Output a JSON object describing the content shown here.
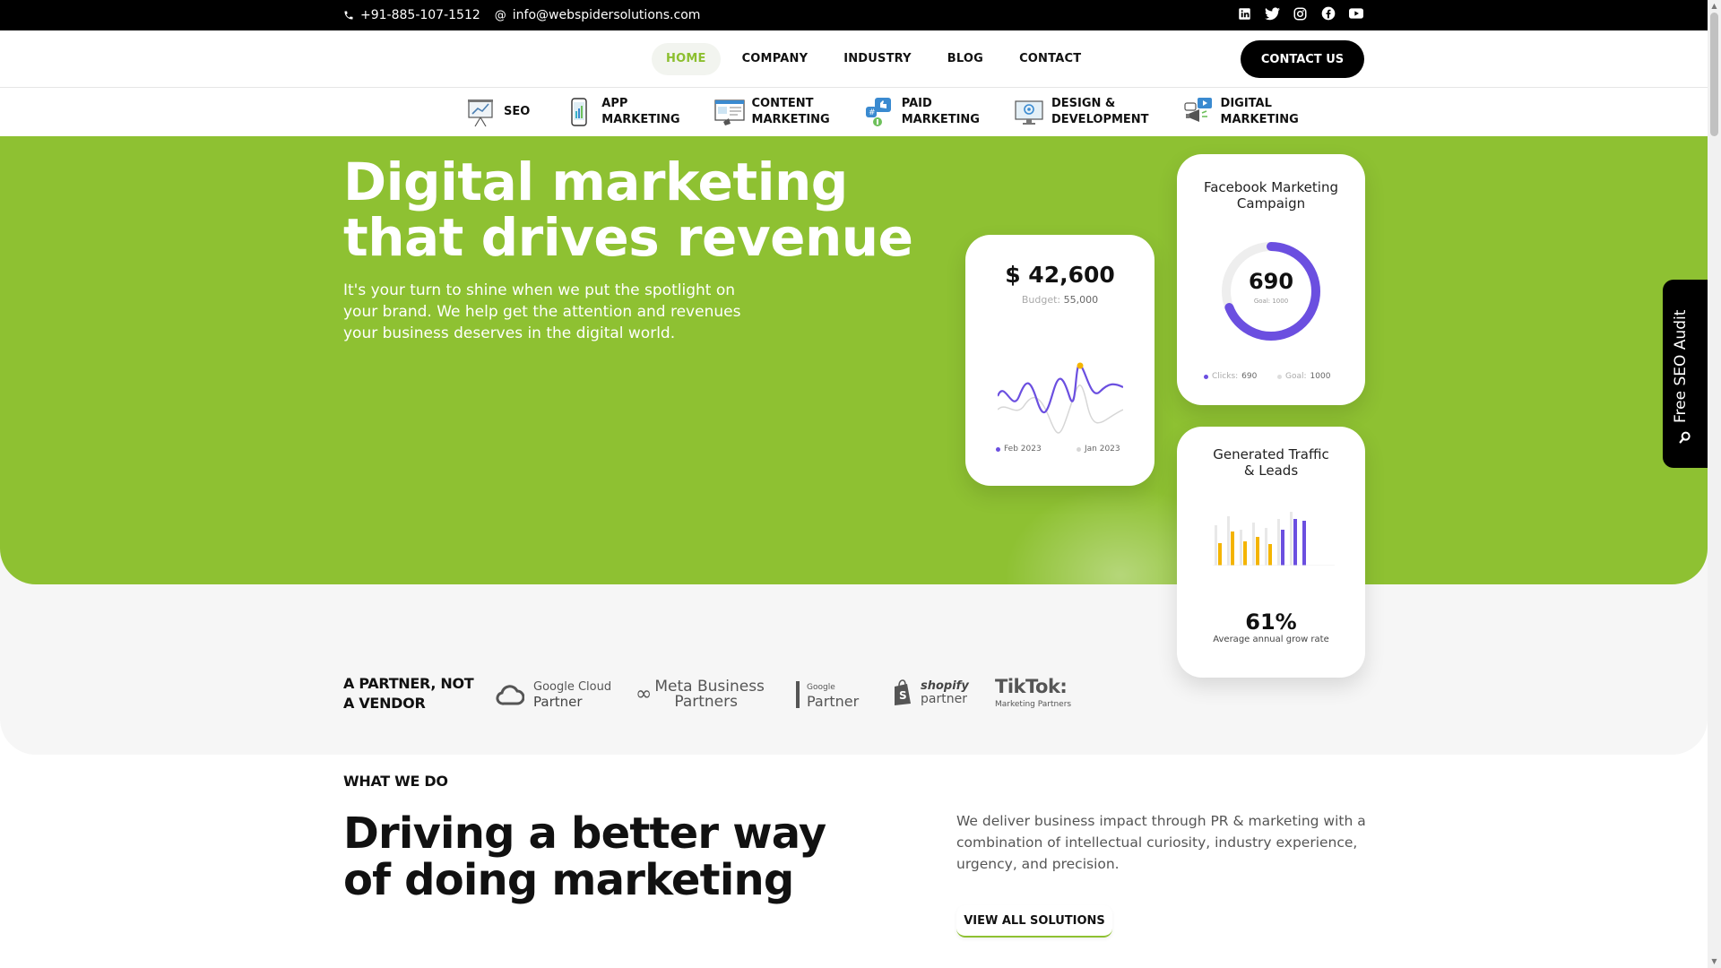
{
  "topbar": {
    "phone": "+91-885-107-1512",
    "email": "info@webspidersolutions.com",
    "social_icons": [
      "linkedin-icon",
      "twitter-icon",
      "instagram-icon",
      "facebook-icon",
      "youtube-icon"
    ]
  },
  "nav": {
    "links": [
      "HOME",
      "COMPANY",
      "INDUSTRY",
      "BLOG",
      "CONTACT"
    ],
    "active": "HOME",
    "cta": "CONTACT US"
  },
  "services": [
    {
      "line1": "SEO",
      "line2": ""
    },
    {
      "line1": "APP",
      "line2": "MARKETING"
    },
    {
      "line1": "CONTENT",
      "line2": "MARKETING"
    },
    {
      "line1": "PAID",
      "line2": "MARKETING"
    },
    {
      "line1": "DESIGN &",
      "line2": "DEVELOPMENT"
    },
    {
      "line1": "DIGITAL",
      "line2": "MARKETING"
    }
  ],
  "hero": {
    "title_line1": "Digital marketing",
    "title_line2": "that drives revenue",
    "text": "It's your turn to shine when we put the spotlight on your brand. We help get the attention and revenues your business deserves in the digital world."
  },
  "card_spend": {
    "amount": "$ 42,600",
    "budget_label": "Budget:",
    "budget_value": "55,000",
    "legend_current": "Feb 2023",
    "legend_previous": "Jan 2023"
  },
  "card_facebook": {
    "title": "Facebook Marketing Campaign",
    "value": "690",
    "goal_label": "Goal: 1000",
    "progress": 0.69,
    "legend_clicks_label": "Clicks:",
    "legend_clicks_value": "690",
    "legend_goal_label": "Goal:",
    "legend_goal_value": "1000"
  },
  "card_traffic": {
    "title_line1": "Generated Traffic",
    "title_line2": "& Leads",
    "percent": "61%",
    "subtitle": "Average annual grow rate"
  },
  "seo_tab": {
    "label": "Free SEO Audit"
  },
  "partners": {
    "title_line1": "A PARTNER, NOT",
    "title_line2": "A VENDOR",
    "google_cloud_line1": "Google Cloud",
    "google_cloud_line2": "Partner",
    "meta_line1": "Meta Business",
    "meta_line2": "Partners",
    "google_partner_small": "Google",
    "google_partner_big": "Partner",
    "shopify_line1": "shopify",
    "shopify_line2": "partner",
    "tiktok_line1": "TikTok:",
    "tiktok_line2": "Marketing Partners"
  },
  "what_we_do": {
    "label": "WHAT WE DO",
    "title_line1": "Driving a better way",
    "title_line2": "of doing marketing",
    "text": "We deliver business impact through PR & marketing with a combination of intellectual curiosity, industry experience, urgency, and precision.",
    "button": "VIEW ALL SOLUTIONS"
  },
  "colors": {
    "accent": "#8ec132",
    "purple": "#6b4fe0",
    "yellow": "#f4b400",
    "dark": "#000000"
  }
}
